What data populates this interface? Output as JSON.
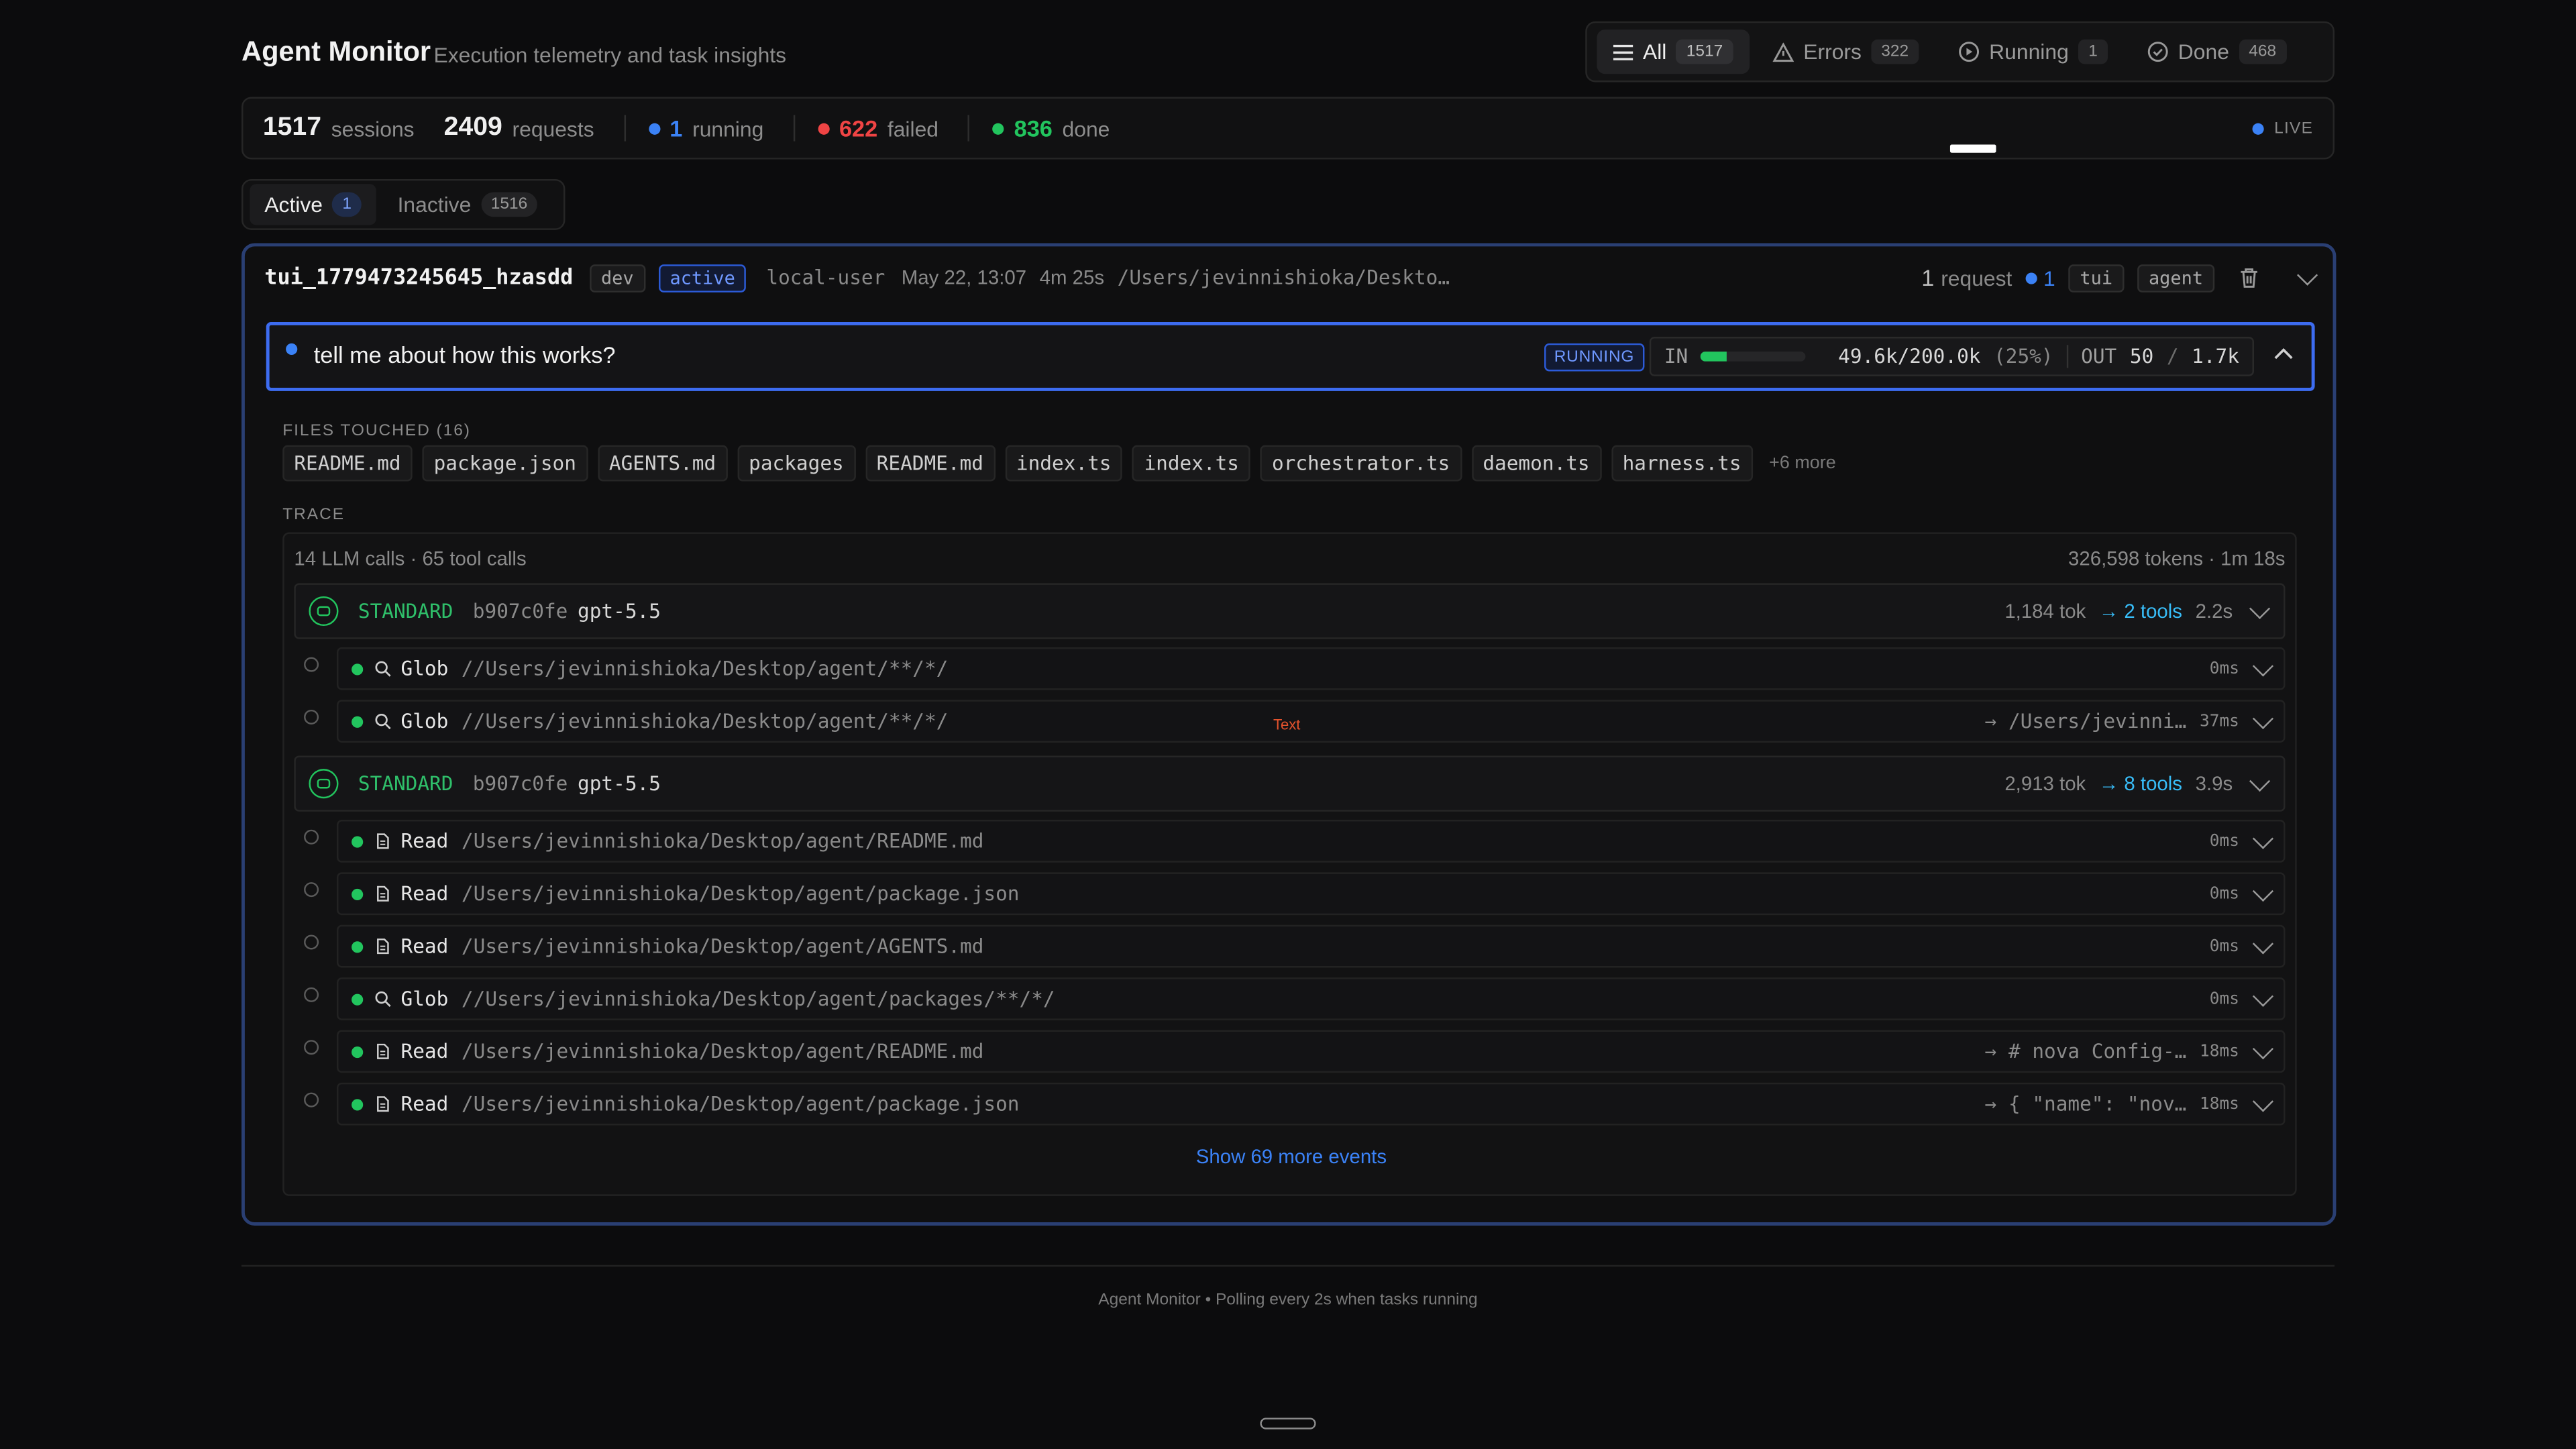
{
  "header": {
    "title": "Agent Monitor",
    "subtitle": "Execution telemetry and task insights"
  },
  "filters": [
    {
      "label": "All",
      "count": "1517",
      "icon": "list-icon"
    },
    {
      "label": "Errors",
      "count": "322",
      "icon": "warning-icon"
    },
    {
      "label": "Running",
      "count": "1",
      "icon": "play-circle-icon"
    },
    {
      "label": "Done",
      "count": "468",
      "icon": "check-circle-icon"
    }
  ],
  "stats": {
    "sessions": "1517",
    "sessions_label": "sessions",
    "requests": "2409",
    "requests_label": "requests",
    "running": "1",
    "running_label": "running",
    "failed": "622",
    "failed_label": "failed",
    "done": "836",
    "done_label": "done",
    "live": "LIVE"
  },
  "activity_tabs": [
    {
      "label": "Active",
      "count": "1"
    },
    {
      "label": "Inactive",
      "count": "1516"
    }
  ],
  "session": {
    "id": "tui_1779473245645_hzasdd",
    "env": "dev",
    "status": "active",
    "user": "local-user",
    "date": "May 22, 13:07",
    "duration": "4m 25s",
    "path": "/Users/jevinnishioka/Deskto…",
    "requests": "1",
    "requests_label": "request",
    "running": "1",
    "tags": [
      "tui",
      "agent"
    ]
  },
  "request": {
    "title": "tell me about how this works?",
    "status": "RUNNING",
    "in_label": "IN",
    "in_value": "49.6k/200.0k",
    "in_pct": "(25%)",
    "in_fraction": 0.25,
    "out_label": "OUT",
    "out_value": "50",
    "out_sep": "/",
    "out_total": "1.7k"
  },
  "files": {
    "label": "FILES TOUCHED (16)",
    "items": [
      "README.md",
      "package.json",
      "AGENTS.md",
      "packages",
      "README.md",
      "index.ts",
      "index.ts",
      "orchestrator.ts",
      "daemon.ts",
      "harness.ts"
    ],
    "more": "+6 more"
  },
  "trace": {
    "label": "TRACE",
    "summary_left": "14 LLM calls · 65 tool calls",
    "summary_right": "326,598 tokens · 1m 18s",
    "llm_calls": [
      {
        "kind": "STANDARD",
        "hash": "b907c0fe",
        "model": "gpt-5.5",
        "tokens": "1,184 tok",
        "tools": "→ 2 tools",
        "time": "2.2s",
        "tools_list": [
          {
            "name": "Glob",
            "icon": "search-icon",
            "arg": "//Users/jevinnishioka/Desktop/agent/**/*/",
            "result": "",
            "time": "0ms"
          },
          {
            "name": "Glob",
            "icon": "search-icon",
            "arg": "//Users/jevinnishioka/Desktop/agent/**/*/",
            "result": "→ /Users/jevinni…",
            "time": "37ms"
          }
        ]
      },
      {
        "kind": "STANDARD",
        "hash": "b907c0fe",
        "model": "gpt-5.5",
        "tokens": "2,913 tok",
        "tools": "→ 8 tools",
        "time": "3.9s",
        "tools_list": [
          {
            "name": "Read",
            "icon": "file-icon",
            "arg": "/Users/jevinnishioka/Desktop/agent/README.md",
            "result": "",
            "time": "0ms"
          },
          {
            "name": "Read",
            "icon": "file-icon",
            "arg": "/Users/jevinnishioka/Desktop/agent/package.json",
            "result": "",
            "time": "0ms"
          },
          {
            "name": "Read",
            "icon": "file-icon",
            "arg": "/Users/jevinnishioka/Desktop/agent/AGENTS.md",
            "result": "",
            "time": "0ms"
          },
          {
            "name": "Glob",
            "icon": "search-icon",
            "arg": "//Users/jevinnishioka/Desktop/agent/packages/**/*/",
            "result": "",
            "time": "0ms"
          },
          {
            "name": "Read",
            "icon": "file-icon",
            "arg": "/Users/jevinnishioka/Desktop/agent/README.md",
            "result": "→ # nova Config-…",
            "time": "18ms"
          },
          {
            "name": "Read",
            "icon": "file-icon",
            "arg": "/Users/jevinnishioka/Desktop/agent/package.json",
            "result": "→ { \"name\": \"nov…",
            "time": "18ms"
          }
        ]
      }
    ],
    "show_more": "Show 69 more events"
  },
  "stray_label": "Text",
  "footer": "Agent Monitor • Polling every 2s when tasks running",
  "colors": {
    "accent": "#3b82f6",
    "success": "#22c55e",
    "error": "#ef4444",
    "background": "#0c0c0d"
  }
}
